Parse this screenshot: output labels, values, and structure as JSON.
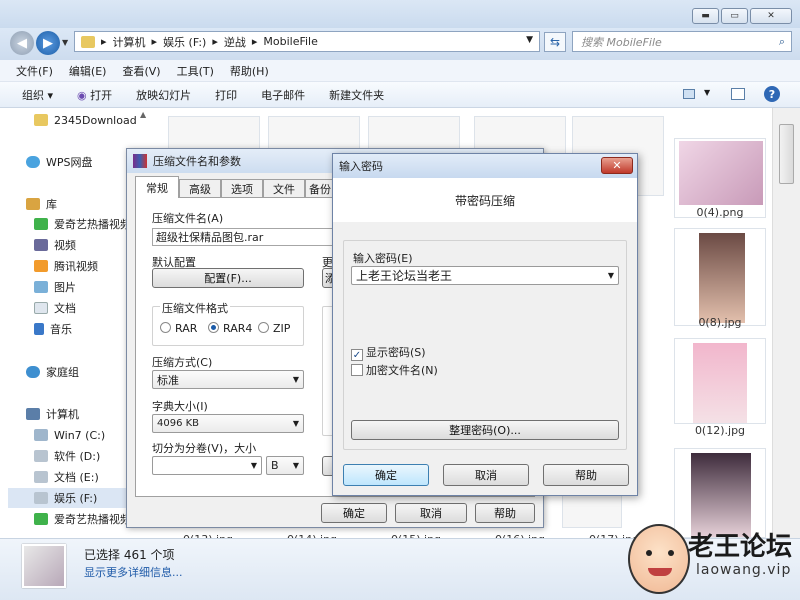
{
  "explorer": {
    "address": [
      "计算机",
      "娱乐 (F:)",
      "逆战",
      "MobileFile"
    ],
    "search_placeholder": "搜索 MobileFile",
    "menu": [
      "文件(F)",
      "编辑(E)",
      "查看(V)",
      "工具(T)",
      "帮助(H)"
    ],
    "toolbar": [
      "组织 ▾",
      "打开",
      "放映幻灯片",
      "打印",
      "电子邮件",
      "新建文件夹"
    ],
    "sidebar": [
      {
        "label": "2345Download",
        "icon": "folder-icon"
      },
      {
        "label": "WPS网盘",
        "icon": "cloud-icon"
      },
      {
        "label": "库",
        "icon": "library-icon"
      },
      {
        "label": "爱奇艺热播视频",
        "icon": "iqiyi-icon"
      },
      {
        "label": "视频",
        "icon": "video-icon"
      },
      {
        "label": "腾讯视频",
        "icon": "tencent-video-icon"
      },
      {
        "label": "图片",
        "icon": "picture-icon"
      },
      {
        "label": "文档",
        "icon": "document-icon"
      },
      {
        "label": "音乐",
        "icon": "music-icon"
      },
      {
        "label": "家庭组",
        "icon": "homegroup-icon"
      },
      {
        "label": "计算机",
        "icon": "computer-icon"
      },
      {
        "label": "Win7 (C:)",
        "icon": "drive-icon"
      },
      {
        "label": "软件 (D:)",
        "icon": "drive-icon"
      },
      {
        "label": "文档 (E:)",
        "icon": "drive-icon"
      },
      {
        "label": "娱乐 (F:)",
        "icon": "drive-icon"
      },
      {
        "label": "爱奇艺热播视频",
        "icon": "iqiyi-icon"
      }
    ],
    "thumb_captions": [
      "0(4).png",
      "0(8).jpg",
      "0(12).jpg",
      "0(13).jpg",
      "0(14).jpg",
      "0(15).jpg",
      "0(16).jpg",
      "0(17).jpg"
    ],
    "status": {
      "selected": "已选择 461 个项",
      "more": "显示更多详细信息..."
    }
  },
  "rar_dialog": {
    "title": "压缩文件名和参数",
    "tabs": [
      "常规",
      "高级",
      "选项",
      "文件",
      "备份"
    ],
    "archive_name_label": "压缩文件名(A)",
    "archive_name": "超级社保精品图包.rar",
    "default_config_label": "默认配置",
    "config_button": "配置(F)...",
    "update_label": "更",
    "add_button": "添",
    "format_label": "压缩文件格式",
    "formats": [
      "RAR",
      "RAR4",
      "ZIP"
    ],
    "format_selected": "RAR4",
    "method_label": "压缩方式(C)",
    "method": "标准",
    "dict_label": "字典大小(I)",
    "dict": "4096 KB",
    "split_label": "切分为分卷(V)，大小",
    "split_unit": "B",
    "ok": "确定",
    "cancel": "取消",
    "help": "帮助"
  },
  "password_dialog": {
    "title": "输入密码",
    "heading": "带密码压缩",
    "password_label": "输入密码(E)",
    "password_value": "上老王论坛当老王",
    "show_password": "显示密码(S)",
    "show_password_checked": true,
    "encrypt_names": "加密文件名(N)",
    "encrypt_names_checked": false,
    "manage_button": "整理密码(O)...",
    "ok": "确定",
    "cancel": "取消",
    "help": "帮助"
  },
  "watermark": {
    "name": "老王论坛",
    "url": "laowang.vip"
  }
}
